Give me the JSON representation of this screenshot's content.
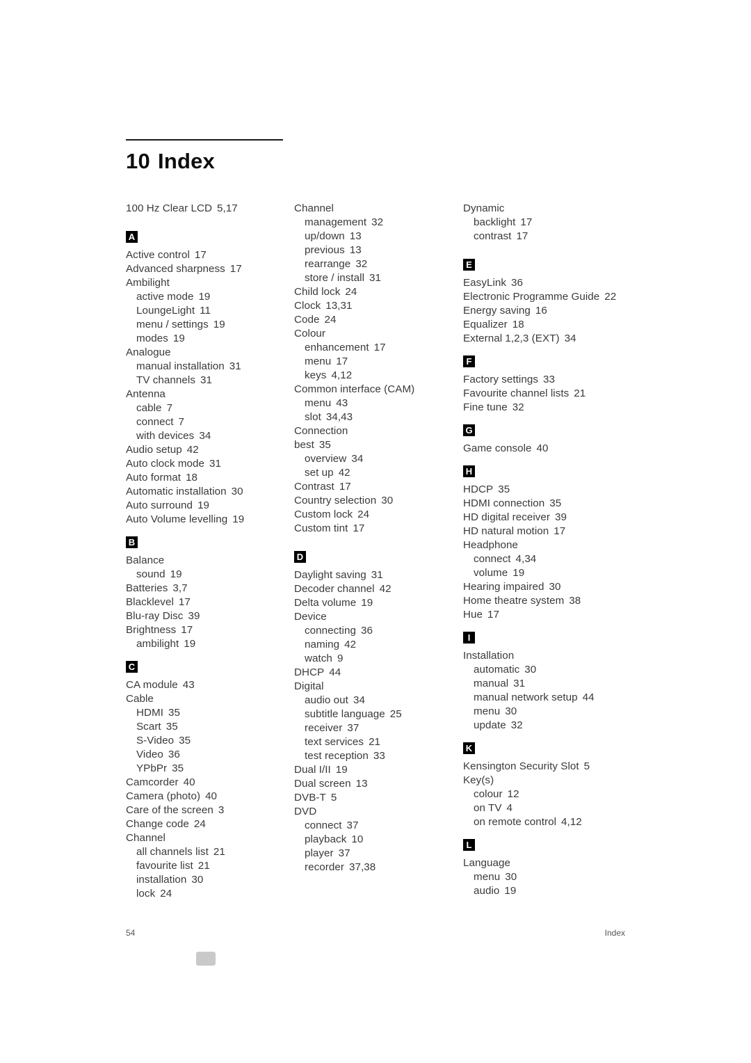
{
  "document": {
    "chapter_number": "10",
    "chapter_title": "Index",
    "footer": {
      "page_number": "54",
      "section_label": "Index"
    }
  },
  "columns": [
    {
      "name": "column-1",
      "blocks": [
        {
          "type": "entries",
          "items": [
            {
              "text": "100 Hz Clear LCD",
              "pages": "5,17",
              "sub": false
            }
          ]
        },
        {
          "type": "letter",
          "letter": "A"
        },
        {
          "type": "entries",
          "items": [
            {
              "text": "Active control",
              "pages": "17",
              "sub": false
            },
            {
              "text": "Advanced sharpness",
              "pages": "17",
              "sub": false
            },
            {
              "text": "Ambilight",
              "pages": "",
              "sub": false
            },
            {
              "text": "active mode",
              "pages": "19",
              "sub": true
            },
            {
              "text": "LoungeLight",
              "pages": "11",
              "sub": true
            },
            {
              "text": "menu / settings",
              "pages": "19",
              "sub": true
            },
            {
              "text": "modes",
              "pages": "19",
              "sub": true
            },
            {
              "text": "Analogue",
              "pages": "",
              "sub": false
            },
            {
              "text": "manual installation",
              "pages": "31",
              "sub": true
            },
            {
              "text": "TV channels",
              "pages": "31",
              "sub": true
            },
            {
              "text": "Antenna",
              "pages": "",
              "sub": false
            },
            {
              "text": "cable",
              "pages": "7",
              "sub": true
            },
            {
              "text": "connect",
              "pages": "7",
              "sub": true
            },
            {
              "text": "with devices",
              "pages": "34",
              "sub": true
            },
            {
              "text": "Audio setup",
              "pages": "42",
              "sub": false
            },
            {
              "text": "Auto clock mode",
              "pages": "31",
              "sub": false
            },
            {
              "text": "Auto format",
              "pages": "18",
              "sub": false
            },
            {
              "text": "Automatic installation",
              "pages": "30",
              "sub": false
            },
            {
              "text": "Auto surround",
              "pages": "19",
              "sub": false
            },
            {
              "text": "Auto Volume levelling",
              "pages": "19",
              "sub": false
            }
          ]
        },
        {
          "type": "letter",
          "letter": "B"
        },
        {
          "type": "entries",
          "items": [
            {
              "text": "Balance",
              "pages": "",
              "sub": false
            },
            {
              "text": "sound",
              "pages": "19",
              "sub": true
            },
            {
              "text": "Batteries",
              "pages": "3,7",
              "sub": false
            },
            {
              "text": "Blacklevel",
              "pages": "17",
              "sub": false
            },
            {
              "text": "Blu-ray Disc",
              "pages": "39",
              "sub": false
            },
            {
              "text": "Brightness",
              "pages": "17",
              "sub": false
            },
            {
              "text": "ambilight",
              "pages": "19",
              "sub": true
            }
          ]
        },
        {
          "type": "letter",
          "letter": "C"
        },
        {
          "type": "entries",
          "items": [
            {
              "text": "CA module",
              "pages": "43",
              "sub": false
            },
            {
              "text": "Cable",
              "pages": "",
              "sub": false
            },
            {
              "text": "HDMI",
              "pages": "35",
              "sub": true
            },
            {
              "text": "Scart",
              "pages": "35",
              "sub": true
            },
            {
              "text": "S-Video",
              "pages": "35",
              "sub": true
            },
            {
              "text": "Video",
              "pages": "36",
              "sub": true
            },
            {
              "text": "YPbPr",
              "pages": "35",
              "sub": true
            },
            {
              "text": "Camcorder",
              "pages": "40",
              "sub": false
            },
            {
              "text": "Camera (photo)",
              "pages": "40",
              "sub": false
            },
            {
              "text": "Care of the screen",
              "pages": "3",
              "sub": false
            },
            {
              "text": "Change code",
              "pages": "24",
              "sub": false
            },
            {
              "text": "Channel",
              "pages": "",
              "sub": false
            },
            {
              "text": "all channels list",
              "pages": "21",
              "sub": true
            },
            {
              "text": "favourite list",
              "pages": "21",
              "sub": true
            },
            {
              "text": "installation",
              "pages": "30",
              "sub": true
            },
            {
              "text": "lock",
              "pages": "24",
              "sub": true
            }
          ]
        }
      ]
    },
    {
      "name": "column-2",
      "blocks": [
        {
          "type": "entries",
          "items": [
            {
              "text": "Channel",
              "pages": "",
              "sub": false
            },
            {
              "text": "management",
              "pages": "32",
              "sub": true
            },
            {
              "text": "up/down",
              "pages": "13",
              "sub": true
            },
            {
              "text": "previous",
              "pages": "13",
              "sub": true
            },
            {
              "text": "rearrange",
              "pages": "32",
              "sub": true
            },
            {
              "text": "store / install",
              "pages": "31",
              "sub": true
            },
            {
              "text": "Child lock",
              "pages": "24",
              "sub": false
            },
            {
              "text": "Clock",
              "pages": "13,31",
              "sub": false
            },
            {
              "text": "Code",
              "pages": "24",
              "sub": false
            },
            {
              "text": "Colour",
              "pages": "",
              "sub": false
            },
            {
              "text": "enhancement",
              "pages": "17",
              "sub": true
            },
            {
              "text": "menu",
              "pages": "17",
              "sub": true
            },
            {
              "text": "keys",
              "pages": "4,12",
              "sub": true
            },
            {
              "text": "Common interface (CAM)",
              "pages": "",
              "sub": false
            },
            {
              "text": "menu",
              "pages": "43",
              "sub": true
            },
            {
              "text": "slot",
              "pages": "34,43",
              "sub": true
            },
            {
              "text": "Connection",
              "pages": "",
              "sub": false
            },
            {
              "text": "best",
              "pages": "35",
              "sub": false
            },
            {
              "text": "overview",
              "pages": "34",
              "sub": true
            },
            {
              "text": "set up",
              "pages": "42",
              "sub": true
            },
            {
              "text": "Contrast",
              "pages": "17",
              "sub": false
            },
            {
              "text": "Country selection",
              "pages": "30",
              "sub": false
            },
            {
              "text": "Custom lock",
              "pages": "24",
              "sub": false
            },
            {
              "text": "Custom tint",
              "pages": "17",
              "sub": false
            }
          ]
        },
        {
          "type": "letter",
          "letter": "D"
        },
        {
          "type": "entries",
          "items": [
            {
              "text": "Daylight saving",
              "pages": "31",
              "sub": false
            },
            {
              "text": "Decoder channel",
              "pages": "42",
              "sub": false
            },
            {
              "text": "Delta volume",
              "pages": "19",
              "sub": false
            },
            {
              "text": "Device",
              "pages": "",
              "sub": false
            },
            {
              "text": "connecting",
              "pages": "36",
              "sub": true
            },
            {
              "text": "naming",
              "pages": "42",
              "sub": true
            },
            {
              "text": "watch",
              "pages": "9",
              "sub": true
            },
            {
              "text": "DHCP",
              "pages": "44",
              "sub": false
            },
            {
              "text": "Digital",
              "pages": "",
              "sub": false
            },
            {
              "text": "audio out",
              "pages": "34",
              "sub": true
            },
            {
              "text": "subtitle language",
              "pages": "25",
              "sub": true
            },
            {
              "text": "receiver",
              "pages": "37",
              "sub": true
            },
            {
              "text": "text services",
              "pages": "21",
              "sub": true
            },
            {
              "text": "test reception",
              "pages": "33",
              "sub": true
            },
            {
              "text": "Dual I/II",
              "pages": "19",
              "sub": false
            },
            {
              "text": "Dual screen",
              "pages": "13",
              "sub": false
            },
            {
              "text": "DVB-T",
              "pages": "5",
              "sub": false
            },
            {
              "text": "DVD",
              "pages": "",
              "sub": false
            },
            {
              "text": "connect",
              "pages": "37",
              "sub": true
            },
            {
              "text": "playback",
              "pages": "10",
              "sub": true
            },
            {
              "text": "player",
              "pages": "37",
              "sub": true
            },
            {
              "text": "recorder",
              "pages": "37,38",
              "sub": true
            }
          ]
        }
      ]
    },
    {
      "name": "column-3",
      "blocks": [
        {
          "type": "entries",
          "items": [
            {
              "text": "Dynamic",
              "pages": "",
              "sub": false
            },
            {
              "text": "backlight",
              "pages": "17",
              "sub": true
            },
            {
              "text": "contrast",
              "pages": "17",
              "sub": true
            }
          ]
        },
        {
          "type": "letter",
          "letter": "E"
        },
        {
          "type": "entries",
          "items": [
            {
              "text": "EasyLink",
              "pages": "36",
              "sub": false
            },
            {
              "text": "Electronic Programme Guide",
              "pages": "22",
              "sub": false
            },
            {
              "text": "Energy saving",
              "pages": "16",
              "sub": false
            },
            {
              "text": "Equalizer",
              "pages": "18",
              "sub": false
            },
            {
              "text": "External 1,2,3 (EXT)",
              "pages": "34",
              "sub": false
            }
          ]
        },
        {
          "type": "letter",
          "letter": "F"
        },
        {
          "type": "entries",
          "items": [
            {
              "text": "Factory settings",
              "pages": "33",
              "sub": false
            },
            {
              "text": "Favourite channel lists",
              "pages": "21",
              "sub": false
            },
            {
              "text": "Fine tune",
              "pages": "32",
              "sub": false
            }
          ]
        },
        {
          "type": "letter",
          "letter": "G"
        },
        {
          "type": "entries",
          "items": [
            {
              "text": "Game console",
              "pages": "40",
              "sub": false
            }
          ]
        },
        {
          "type": "letter",
          "letter": "H"
        },
        {
          "type": "entries",
          "items": [
            {
              "text": "HDCP",
              "pages": "35",
              "sub": false
            },
            {
              "text": "HDMI connection",
              "pages": "35",
              "sub": false
            },
            {
              "text": "HD digital receiver",
              "pages": "39",
              "sub": false
            },
            {
              "text": "HD natural motion",
              "pages": "17",
              "sub": false
            },
            {
              "text": "Headphone",
              "pages": "",
              "sub": false
            },
            {
              "text": "connect",
              "pages": "4,34",
              "sub": true
            },
            {
              "text": "volume",
              "pages": "19",
              "sub": true
            },
            {
              "text": "Hearing impaired",
              "pages": "30",
              "sub": false
            },
            {
              "text": "Home theatre system",
              "pages": "38",
              "sub": false
            },
            {
              "text": "Hue",
              "pages": "17",
              "sub": false
            }
          ]
        },
        {
          "type": "letter",
          "letter": "I"
        },
        {
          "type": "entries",
          "items": [
            {
              "text": "Installation",
              "pages": "",
              "sub": false
            },
            {
              "text": "automatic",
              "pages": "30",
              "sub": true
            },
            {
              "text": "manual",
              "pages": "31",
              "sub": true
            },
            {
              "text": "manual network setup",
              "pages": "44",
              "sub": true
            },
            {
              "text": "menu",
              "pages": "30",
              "sub": true
            },
            {
              "text": "update",
              "pages": "32",
              "sub": true
            }
          ]
        },
        {
          "type": "letter",
          "letter": "K"
        },
        {
          "type": "entries",
          "items": [
            {
              "text": "Kensington Security Slot",
              "pages": "5",
              "sub": false
            },
            {
              "text": "Key(s)",
              "pages": "",
              "sub": false
            },
            {
              "text": "colour",
              "pages": "12",
              "sub": true
            },
            {
              "text": "on TV",
              "pages": "4",
              "sub": true
            },
            {
              "text": "on remote control",
              "pages": "4,12",
              "sub": true
            }
          ]
        },
        {
          "type": "letter",
          "letter": "L"
        },
        {
          "type": "entries",
          "items": [
            {
              "text": "Language",
              "pages": "",
              "sub": false
            },
            {
              "text": "menu",
              "pages": "30",
              "sub": true
            },
            {
              "text": "audio",
              "pages": "19",
              "sub": true
            }
          ]
        }
      ]
    }
  ]
}
